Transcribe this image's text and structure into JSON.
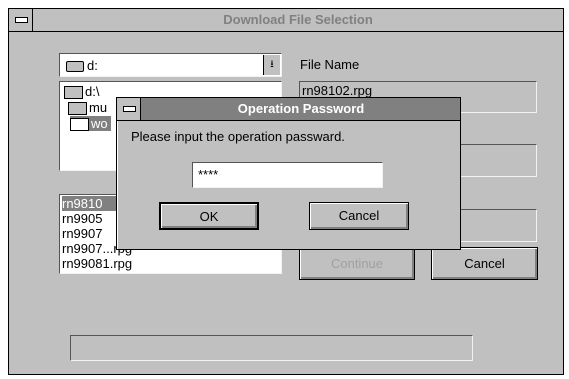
{
  "window": {
    "title": "Download File Selection"
  },
  "drive_select": {
    "value": "d:"
  },
  "dir_list": {
    "items": [
      "d:\\",
      "mu",
      "wo"
    ]
  },
  "file_list": {
    "items": [
      "rn9810",
      "rn9905",
      "rn9907",
      "rn9907...rpg",
      "rn99081.rpg"
    ]
  },
  "file_name": {
    "label": "File Name",
    "value": "rn98102.rpg"
  },
  "buttons": {
    "continue": "Continue",
    "cancel": "Cancel"
  },
  "dialog": {
    "title": "Operation Password",
    "prompt": "Please input the operation passward.",
    "password_value": "****",
    "ok": "OK",
    "cancel": "Cancel"
  }
}
